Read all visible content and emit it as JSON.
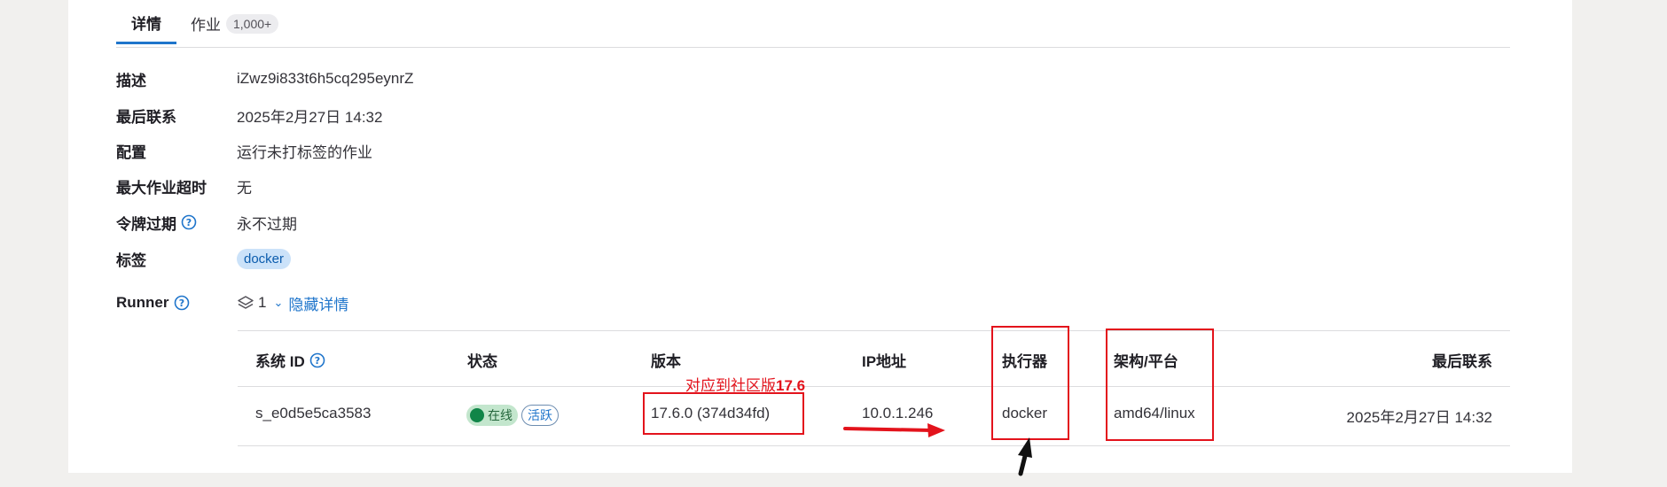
{
  "tabs": [
    {
      "label": "详情"
    },
    {
      "label": "作业",
      "count": "1,000+"
    }
  ],
  "details": [
    {
      "label": "描述",
      "value": "iZwz9i833t6h5cq295eynrZ"
    },
    {
      "label": "最后联系",
      "value": "2025年2月27日 14:32"
    },
    {
      "label": "配置",
      "value": "运行未打标签的作业"
    },
    {
      "label": "最大作业超时",
      "value": "无"
    },
    {
      "label": "令牌过期",
      "value": "永不过期"
    },
    {
      "label": "标签",
      "value": "docker"
    },
    {
      "label": "Runner",
      "count": "1",
      "link": "隐藏详情"
    }
  ],
  "table": {
    "columns": [
      "系统 ID",
      "状态",
      "版本",
      "IP地址",
      "执行器",
      "架构/平台",
      "最后联系"
    ],
    "rows": [
      {
        "system_id": "s_e0d5e5ca3583",
        "status_online": "在线",
        "status_active": "活跃",
        "version": "17.6.0 (374d34fd)",
        "ip": "10.0.1.246",
        "executor": "docker",
        "arch": "amd64/linux",
        "last_contact": "2025年2月27日 14:32"
      }
    ]
  },
  "annotation": {
    "prefix": "对应到社区版",
    "version": "17.6",
    "color": "#e3131c"
  },
  "colors": {
    "accent": "#1f75cb",
    "online": "#108548",
    "annotation": "#e3131c"
  },
  "icons": [
    "question-circle-icon",
    "layers-icon",
    "chevron-down-icon"
  ]
}
